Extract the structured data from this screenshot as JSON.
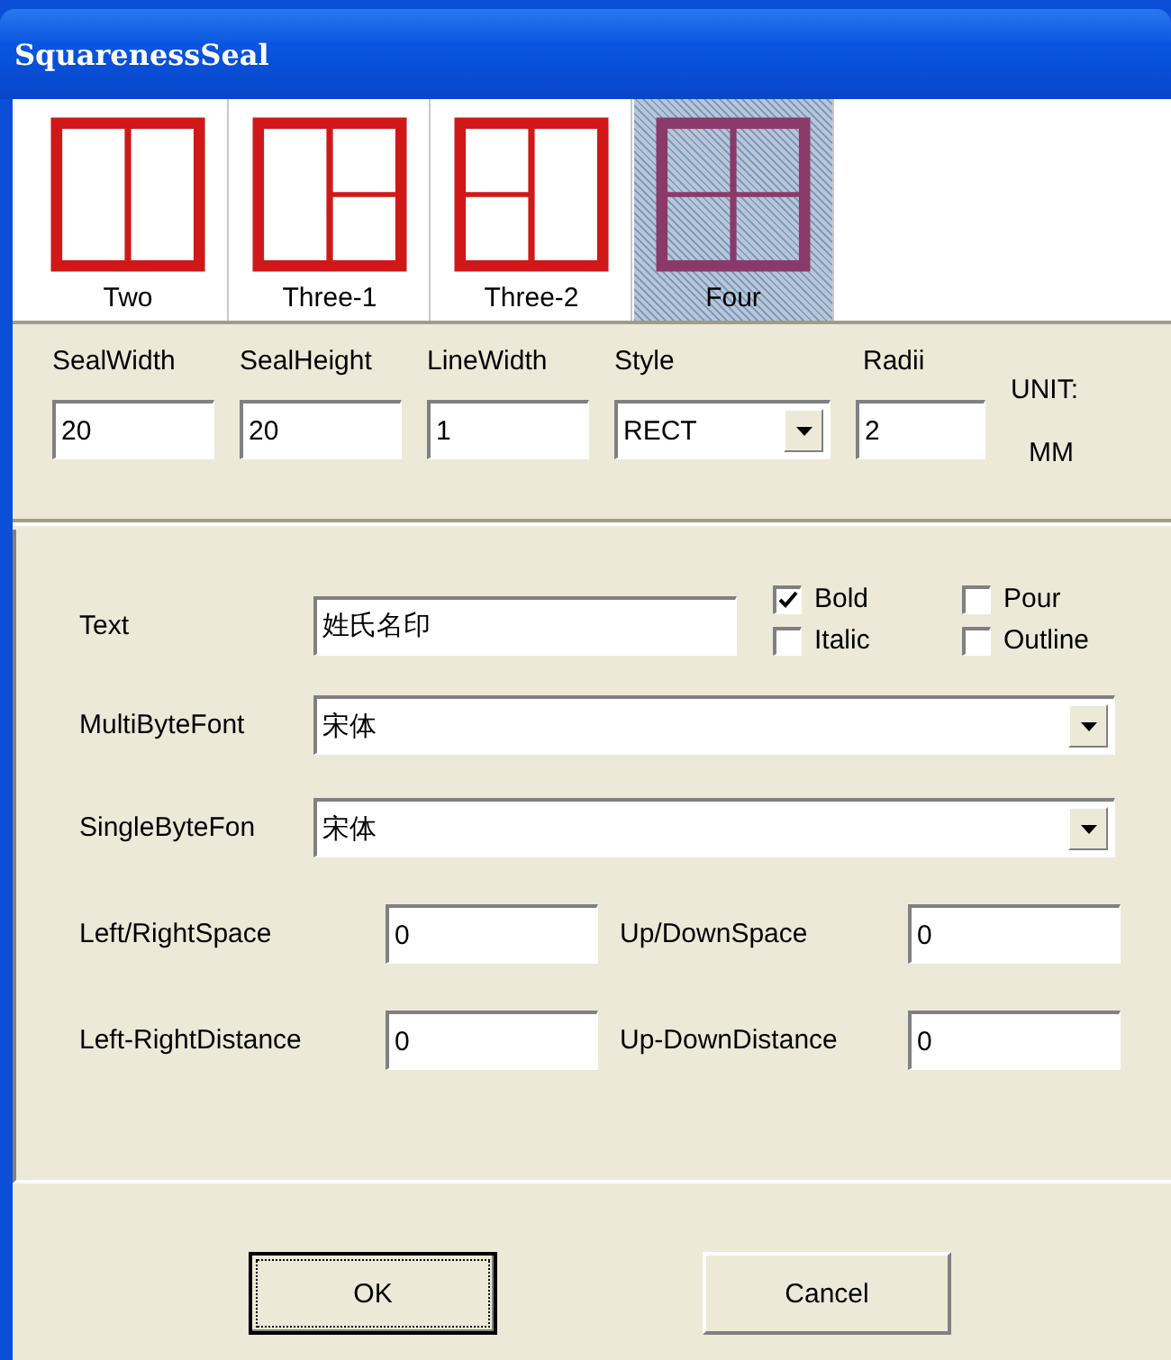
{
  "window": {
    "title": "SquarenessSeal"
  },
  "layouts": [
    {
      "kind": "two",
      "label": "Two",
      "selected": false
    },
    {
      "kind": "three-1",
      "label": "Three-1",
      "selected": false
    },
    {
      "kind": "three-2",
      "label": "Three-2",
      "selected": false
    },
    {
      "kind": "four",
      "label": "Four",
      "selected": true
    }
  ],
  "size": {
    "fields": [
      {
        "label": "SealWidth",
        "value": "20"
      },
      {
        "label": "SealHeight",
        "value": "20"
      },
      {
        "label": "LineWidth",
        "value": "1"
      }
    ],
    "style": {
      "label": "Style",
      "value": "RECT"
    },
    "radii": {
      "label": "Radii",
      "value": "2"
    },
    "unit_label": "UNIT:",
    "unit": "MM"
  },
  "text": {
    "label": "Text",
    "value": "姓氏名印",
    "options": [
      {
        "label": "Bold",
        "checked": true
      },
      {
        "label": "Pour",
        "checked": false
      },
      {
        "label": "Italic",
        "checked": false
      },
      {
        "label": "Outline",
        "checked": false
      }
    ]
  },
  "fonts": [
    {
      "label": "MultiByteFont",
      "value": "宋体"
    },
    {
      "label": "SingleByteFon",
      "value": "宋体"
    }
  ],
  "spacing": [
    {
      "label": "Left/RightSpace",
      "value": "0"
    },
    {
      "label": "Up/DownSpace",
      "value": "0"
    },
    {
      "label": "Left-RightDistance",
      "value": "0"
    },
    {
      "label": "Up-DownDistance",
      "value": "0"
    }
  ],
  "buttons": [
    {
      "label": "OK",
      "default": true
    },
    {
      "label": "Cancel",
      "default": false
    }
  ]
}
